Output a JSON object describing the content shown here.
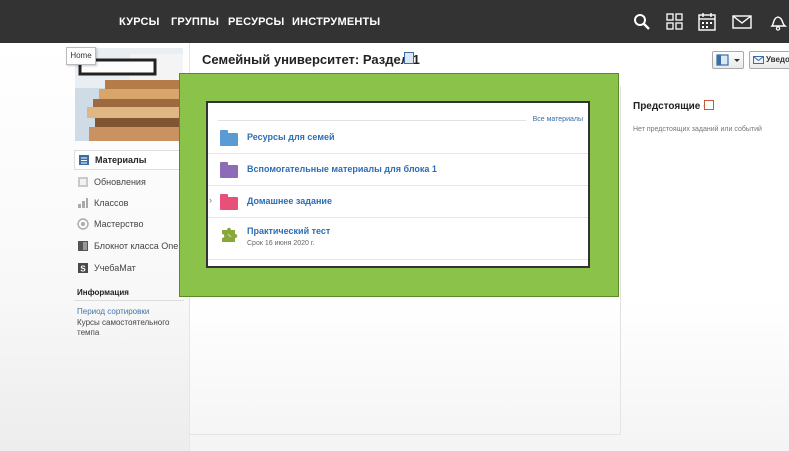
{
  "nav": {
    "items": [
      "КУРСЫ",
      "ГРУППЫ",
      "РЕСУРСЫ",
      "ИНСТРУМЕНТЫ"
    ],
    "icons": [
      "search-icon",
      "apps-grid-icon",
      "calendar-icon",
      "mail-icon",
      "notifications-icon"
    ]
  },
  "tooltip": {
    "home": "Home"
  },
  "sidebar": {
    "items": [
      {
        "label": "Материалы",
        "icon": "materials-icon",
        "active": true
      },
      {
        "label": "Обновления",
        "icon": "updates-icon"
      },
      {
        "label": "Классов",
        "icon": "grades-icon"
      },
      {
        "label": "Мастерство",
        "icon": "mastery-icon"
      },
      {
        "label": "Блокнот класса OneNo",
        "icon": "onenote-icon"
      },
      {
        "label": "УчебаМат",
        "icon": "studymat-icon"
      }
    ],
    "info_heading": "Информация",
    "grading_period_label": "Период сортировки",
    "grading_period_value": "Курсы самостоятельного темпа"
  },
  "main": {
    "title": "Семейный университет: Раздел 1",
    "notify_button": "Уведо"
  },
  "materials": {
    "all_link": "Все материалы",
    "items": [
      {
        "title": "Ресурсы для семей",
        "icon": "folder-blue-icon",
        "color": "#5b9bd5"
      },
      {
        "title": "Вспомогательные материалы для блока 1",
        "icon": "folder-purple-icon",
        "color": "#8e6bb8"
      },
      {
        "title": "Домашнее задание",
        "icon": "folder-pink-icon",
        "color": "#e8507a"
      },
      {
        "title": "Практический тест",
        "icon": "puzzle-icon",
        "color": "#8aa83a",
        "subtitle": "Срок 16 июня 2020 г."
      }
    ]
  },
  "upcoming": {
    "title": "Предстоящие ·",
    "empty": "Нет предстоящих заданий или событий"
  },
  "colors": {
    "nav_bg": "#333333",
    "highlight_green": "#8bc34a",
    "link_blue": "#2d6db5"
  }
}
